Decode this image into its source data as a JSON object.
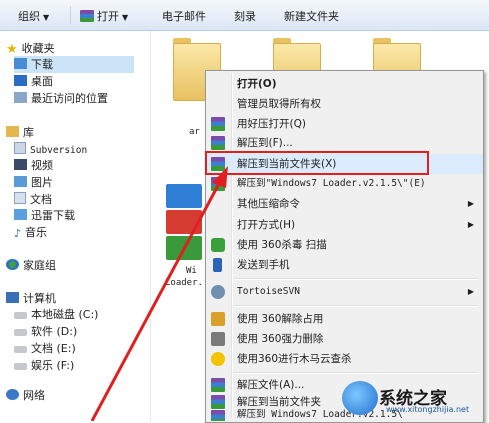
{
  "toolbar": {
    "organize": "组织",
    "open": "打开",
    "email": "电子邮件",
    "burn": "刻录",
    "new_folder": "新建文件夹"
  },
  "nav": {
    "favorites": "收藏夹",
    "downloads": "下载",
    "desktop": "桌面",
    "recent": "最近访问的位置",
    "library": "库",
    "subversion": "Subversion",
    "videos": "视频",
    "pictures": "图片",
    "documents": "文档",
    "xunlei": "迅雷下载",
    "music": "音乐",
    "homegroup": "家庭组",
    "computer": "计算机",
    "local_disk": "本地磁盘 (C:)",
    "software": "软件 (D:)",
    "docs_drive": "文档 (E:)",
    "ent_drive": "娱乐 (F:)",
    "network": "网络"
  },
  "files": {
    "label1": "ar",
    "label2": "Wi",
    "label3": "Loader."
  },
  "menu": {
    "open": "打开(O)",
    "admin": "管理员取得所有权",
    "open_haozip": "用好压打开(Q)",
    "extract_to": "解压到(F)...",
    "extract_here": "解压到当前文件夹(X)",
    "extract_named": "解压到\"Windows7 Loader.v2.1.5\\\"(E)",
    "other_cmds": "其他压缩命令",
    "open_with": "打开方式(H)",
    "scan_360": "使用 360杀毒 扫描",
    "send_phone": "发送到手机",
    "tortoise": "TortoiseSVN",
    "unlock_360": "使用 360解除占用",
    "delete_360": "使用 360强力删除",
    "trojan_360": "使用360进行木马云查杀",
    "extract_files": "解压文件(A)...",
    "extract_current": "解压到当前文件夹",
    "extract_win7": "解压到 Windows7 Loader.v2.1.5\\"
  },
  "watermark": {
    "name": "系统之家",
    "url": "www.xitongzhijia.net"
  },
  "colors": {
    "highlight_box": "#e02020",
    "arrow": "#e02020"
  }
}
